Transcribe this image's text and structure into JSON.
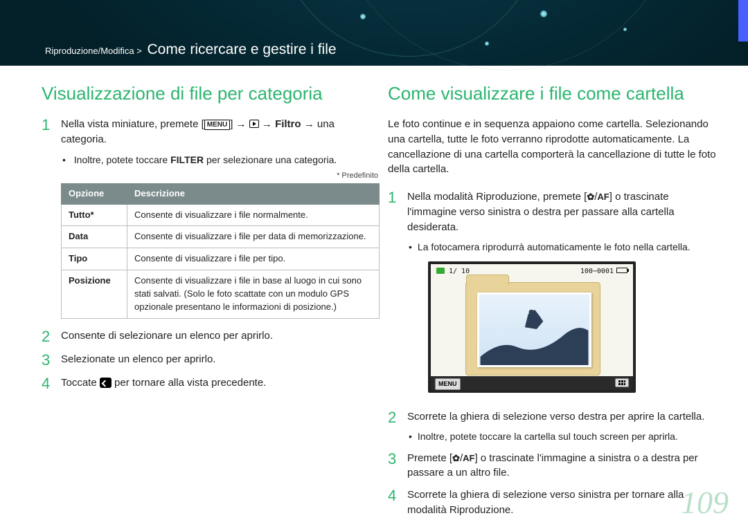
{
  "breadcrumb": {
    "section": "Riproduzione/Modifica",
    "sep": ">",
    "title": "Come ricercare e gestire i file"
  },
  "left": {
    "heading": "Visualizzazione di file per categoria",
    "step1_a": "Nella vista miniature, premete [",
    "step1_menu": "MENU",
    "step1_b": "] → ",
    "step1_c": " → ",
    "step1_filtro": "Filtro",
    "step1_d": " → una categoria.",
    "step1_sub_a": "Inoltre, potete toccare ",
    "step1_filter": "FILTER",
    "step1_sub_b": " per selezionare una categoria.",
    "note": "* Predefinito",
    "th1": "Opzione",
    "th2": "Descrizione",
    "rows": [
      {
        "k": "Tutto*",
        "v": "Consente di visualizzare i file normalmente."
      },
      {
        "k": "Data",
        "v": "Consente di visualizzare i file per data di memorizzazione."
      },
      {
        "k": "Tipo",
        "v": "Consente di visualizzare i file per tipo."
      },
      {
        "k": "Posizione",
        "v": "Consente di visualizzare i file in base al luogo in cui sono stati salvati. (Solo le foto scattate con un modulo GPS opzionale presentano le informazioni di posizione.)"
      }
    ],
    "step2": "Consente di selezionare un elenco per aprirlo.",
    "step3": "Selezionate un elenco per aprirlo.",
    "step4_a": "Toccate ",
    "step4_b": " per tornare alla vista precedente."
  },
  "right": {
    "heading": "Come visualizzare i file come cartella",
    "intro": "Le foto continue e in sequenza appaiono come cartella. Selezionando una cartella, tutte le foto verranno riprodotte automaticamente. La cancellazione di una cartella comporterà la cancellazione di tutte le foto della cartella.",
    "step1_a": "Nella modalità Riproduzione, premete [",
    "step1_b": "/",
    "step1_af": "AF",
    "step1_c": "] o trascinate l'immagine verso sinistra o destra per passare alla cartella desiderata.",
    "step1_sub": "La fotocamera riprodurrà automaticamente le foto nella cartella.",
    "screen": {
      "count": "1/ 10",
      "code": "100−0001",
      "menu": "MENU"
    },
    "step2": "Scorrete la ghiera di selezione verso destra per aprire la cartella.",
    "step2_sub": "Inoltre, potete toccare la cartella sul touch screen per aprirla.",
    "step3_a": "Premete [",
    "step3_b": "/",
    "step3_af": "AF",
    "step3_c": "] o trascinate l'immagine a sinistra o a destra per passare a un altro file.",
    "step4": "Scorrete la ghiera di selezione verso sinistra per tornare alla modalità Riproduzione."
  },
  "page": "109"
}
